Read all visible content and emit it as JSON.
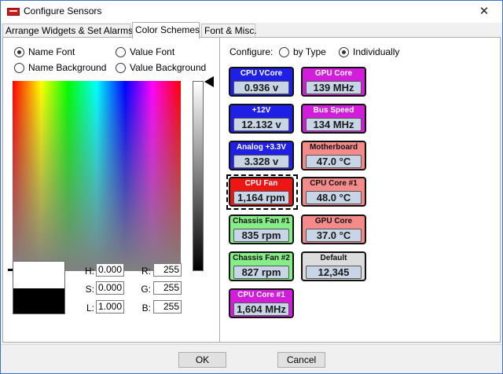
{
  "window": {
    "title": "Configure Sensors",
    "close_glyph": "✕"
  },
  "tabs": [
    {
      "label": "Arrange Widgets & Set Alarms"
    },
    {
      "label": "Color Schemes"
    },
    {
      "label": "Font & Misc."
    }
  ],
  "left": {
    "radios": [
      {
        "label": "Name Font",
        "selected": true
      },
      {
        "label": "Value Font",
        "selected": false
      },
      {
        "label": "Name Background",
        "selected": false
      },
      {
        "label": "Value Background",
        "selected": false
      }
    ],
    "hsl": {
      "h_label": "H:",
      "h": "0.000",
      "s_label": "S:",
      "s": "0.000",
      "l_label": "L:",
      "l": "1.000"
    },
    "rgb": {
      "r_label": "R:",
      "r": "255",
      "g_label": "G:",
      "g": "255",
      "b_label": "B:",
      "b": "255"
    }
  },
  "right": {
    "configure_label": "Configure:",
    "by_type_label": "by Type",
    "individually_label": "Individually",
    "mode": "individually",
    "widgets": [
      {
        "name": "CPU VCore",
        "value": "0.936 v",
        "bg": "#1f1fe6",
        "fg": "#ffffff"
      },
      {
        "name": "GPU Core",
        "value": "139 MHz",
        "bg": "#d21edb",
        "fg": "#ffffff"
      },
      {
        "name": "+12V",
        "value": "12.132 v",
        "bg": "#1f1fe6",
        "fg": "#ffffff"
      },
      {
        "name": "Bus Speed",
        "value": "134 MHz",
        "bg": "#d21edb",
        "fg": "#ffffff"
      },
      {
        "name": "Analog +3.3V",
        "value": "3.328 v",
        "bg": "#1f1fe6",
        "fg": "#ffffff"
      },
      {
        "name": "Motherboard",
        "value": "47.0 °C",
        "bg": "#f48a8a",
        "fg": "#111111"
      },
      {
        "name": "CPU Fan",
        "value": "1,164 rpm",
        "bg": "#ee1515",
        "fg": "#ffffff"
      },
      {
        "name": "CPU Core #1",
        "value": "48.0 °C",
        "bg": "#f48a8a",
        "fg": "#111111"
      },
      {
        "name": "Chassis Fan #1",
        "value": "835 rpm",
        "bg": "#86ee86",
        "fg": "#111111"
      },
      {
        "name": "GPU Core",
        "value": "37.0 °C",
        "bg": "#f48a8a",
        "fg": "#111111"
      },
      {
        "name": "Chassis Fan #2",
        "value": "827 rpm",
        "bg": "#86ee86",
        "fg": "#111111"
      },
      {
        "name": "Default",
        "value": "12,345",
        "bg": "#dcdcdc",
        "fg": "#111111"
      },
      {
        "name": "CPU Core #1",
        "value": "1,604 MHz",
        "bg": "#d21edb",
        "fg": "#ffffff"
      }
    ]
  },
  "buttons": {
    "ok": "OK",
    "cancel": "Cancel"
  }
}
